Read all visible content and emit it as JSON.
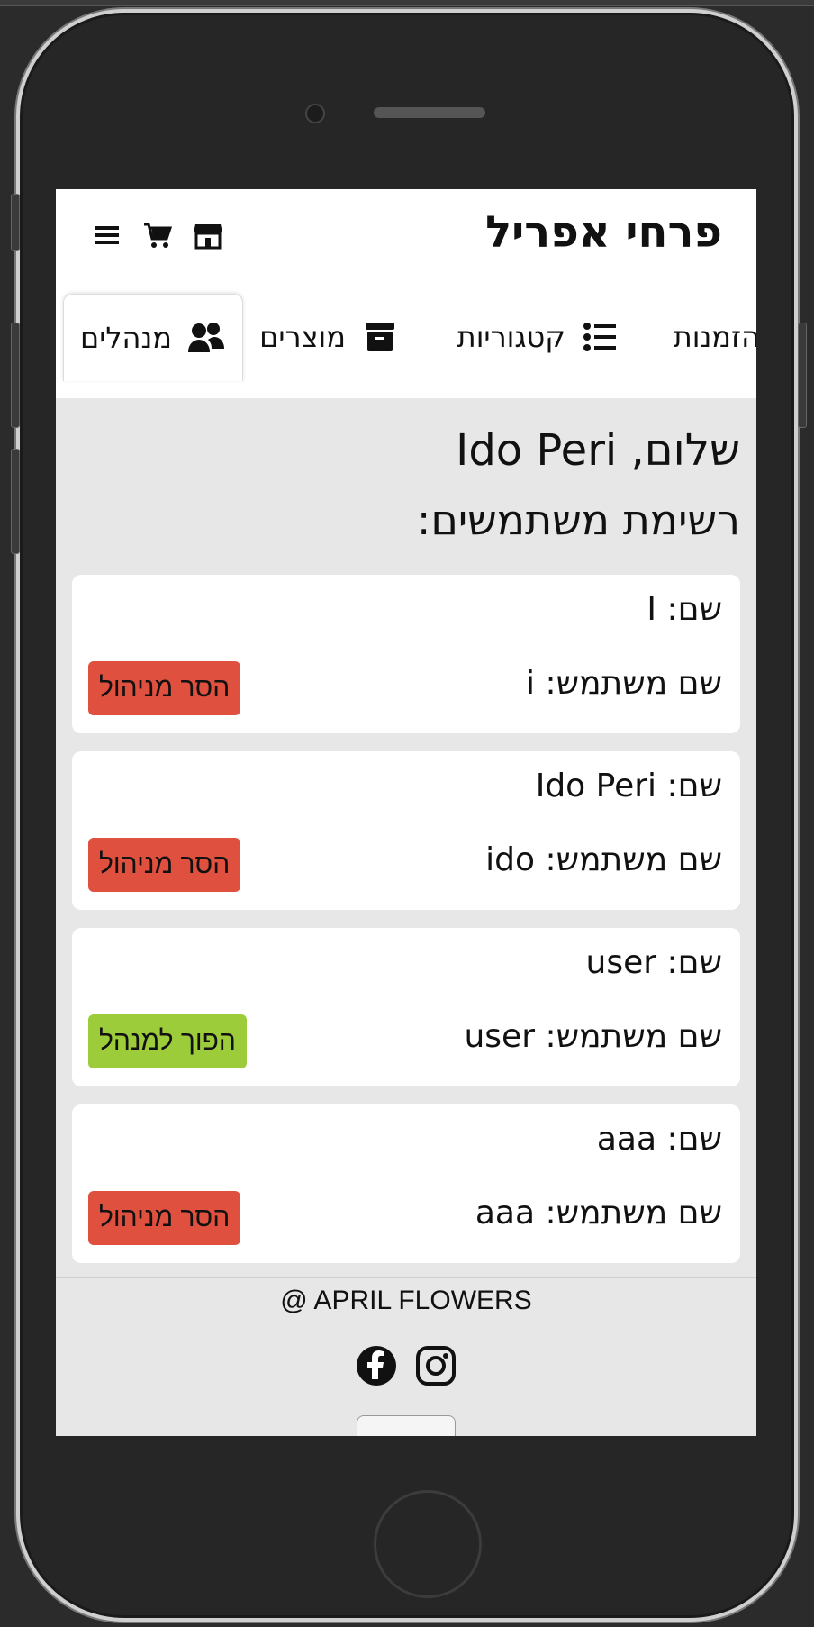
{
  "app": {
    "brand": "פרחי אפריל"
  },
  "header_icons": [
    "menu-icon",
    "cart-icon",
    "store-icon"
  ],
  "tabs": [
    {
      "label": "מנהלים",
      "icon": "users-icon",
      "active": true
    },
    {
      "label": "מוצרים",
      "icon": "box-icon",
      "active": false
    },
    {
      "label": "קטגוריות",
      "icon": "list-icon",
      "active": false
    },
    {
      "label": "הזמנות",
      "icon": "",
      "active": false
    }
  ],
  "main": {
    "greeting": "שלום, Ido Peri",
    "list_title": "רשימת משתמשים:"
  },
  "users": [
    {
      "name_line": "שם: I",
      "username_line": "שם משתמש: i",
      "button": "הסר מניהול",
      "button_type": "remove"
    },
    {
      "name_line": "שם: Ido Peri",
      "username_line": "שם משתמש: ido",
      "button": "הסר מניהול",
      "button_type": "remove"
    },
    {
      "name_line": "שם: user",
      "username_line": "שם משתמש: user",
      "button": "הפוך למנהל",
      "button_type": "make"
    },
    {
      "name_line": "שם: aaa",
      "username_line": "שם משתמש: aaa",
      "button": "הסר מניהול",
      "button_type": "remove"
    }
  ],
  "footer": {
    "copyright": "@ APRIL FLOWERS",
    "social": [
      "facebook-icon",
      "instagram-icon"
    ]
  },
  "colors": {
    "remove": "#e0503f",
    "make": "#9ccc3a",
    "content_bg": "#e7e7e7"
  }
}
